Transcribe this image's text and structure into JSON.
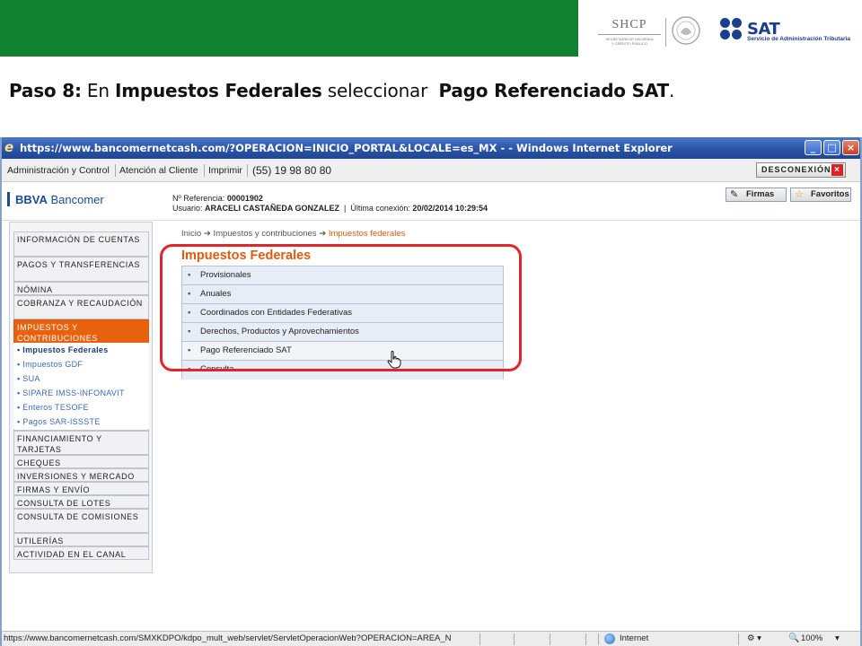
{
  "heading": {
    "step": "Paso 8:",
    "t1": " En ",
    "b1": "Impuestos Federales",
    "t2": " seleccionar  ",
    "b2": "Pago Referenciado SAT",
    "t3": "."
  },
  "logos": {
    "shcp_name": "SHCP",
    "shcp_sub1": "SECRETARÍA DE HACIENDA",
    "shcp_sub2": "Y CRÉDITO PÚBLICO",
    "sat_name": "SAT",
    "sat_sub": "Servicio de Administración Tributaria"
  },
  "browser": {
    "title": "https://www.bancomernetcash.com/?OPERACION=INICIO_PORTAL&LOCALE=es_MX -    - Windows Internet Explorer",
    "status_url": "https://www.bancomernetcash.com/SMXKDPO/kdpo_mult_web/servlet/ServletOperacionWeb?OPERACION=AREA_N",
    "zone": "Internet",
    "zoom": "100%"
  },
  "toolbar": {
    "admin": "Administración y Control",
    "attention": "Atención al Cliente",
    "print": "Imprimir",
    "phone": "(55) 19 98 80 80",
    "logout": "DESCONEXIÓN"
  },
  "header": {
    "bank_bold": "BBVA",
    "bank_rest": " Bancomer",
    "ref_label": "Nº Referencia: ",
    "ref_value": "00001902",
    "user_label": "Usuario: ",
    "user_value": "ARACELI CASTAÑEDA GONZALEZ",
    "conn_label": "  |  Última conexión: ",
    "conn_value": "20/02/2014 10:29:54",
    "firmas": "Firmas",
    "favoritos": "Favoritos"
  },
  "sidebar": {
    "sections": [
      "INFORMACIÓN DE CUENTAS",
      "PAGOS Y TRANSFERENCIAS",
      "NÓMINA",
      "COBRANZA Y RECAUDACIÓN",
      "IMPUESTOS Y CONTRIBUCIONES",
      "FINANCIAMIENTO Y TARJETAS",
      "CHEQUES",
      "INVERSIONES Y MERCADO",
      "FIRMAS Y ENVÍO",
      "CONSULTA DE LOTES",
      "CONSULTA DE COMISIONES",
      "UTILERÍAS",
      "ACTIVIDAD EN EL CANAL"
    ],
    "subitems": [
      "Impuestos Federales",
      "Impuestos GDF",
      "SUA",
      "SIPARE IMSS-INFONAVIT",
      "Enteros TESOFE",
      "Pagos SAR-ISSSTE"
    ]
  },
  "content": {
    "breadcrumb": [
      "Inicio",
      "Impuestos y contribuciones",
      "Impuestos federales"
    ],
    "title": "Impuestos Federales",
    "menu": [
      "Provisionales",
      "Anuales",
      "Coordinados con Entidades Federativas",
      "Derechos, Productos y Aprovechamientos",
      "Pago Referenciado SAT",
      "Consulta"
    ]
  },
  "colors": {
    "banner_green": "#118031",
    "accent_orange": "#e05a0f",
    "highlight_red": "#e0262b",
    "bbva_blue": "#1d4a93"
  }
}
